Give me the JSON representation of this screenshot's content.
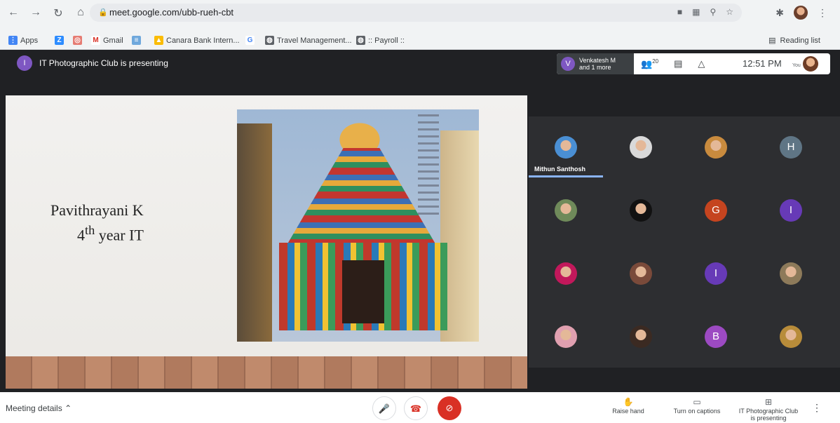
{
  "browser": {
    "url": "meet.google.com/ubb-rueh-cbt",
    "bookmarks": [
      "Apps",
      "Gmail",
      "Canara Bank Intern...",
      "Travel Management...",
      ":: Payroll ::"
    ],
    "reading_list": "Reading list"
  },
  "meet": {
    "presenter_initial": "I",
    "presenting_text": "IT Photographic Club is presenting",
    "active_speaker_initial": "V",
    "active_speaker_name": "Venkatesh M",
    "active_speaker_more": "and 1 more",
    "participant_count": "20",
    "time": "12:51 PM",
    "you_label": "You"
  },
  "slide": {
    "name": "Pavithrayani K",
    "year_num": "4",
    "year_sup": "th",
    "year_rest": " year IT"
  },
  "participants": [
    {
      "type": "photo",
      "color": "#4a8fd4",
      "name": "Mithun Santhosh",
      "speaking": true
    },
    {
      "type": "photo",
      "color": "#d9d9d9"
    },
    {
      "type": "photo",
      "color": "#c98b3e"
    },
    {
      "type": "initial",
      "initial": "H",
      "color": "#5f7585"
    },
    {
      "type": "photo",
      "color": "#6f8a5a"
    },
    {
      "type": "photo",
      "color": "#111111"
    },
    {
      "type": "initial",
      "initial": "G",
      "color": "#c5441f"
    },
    {
      "type": "initial",
      "initial": "I",
      "color": "#673ab7"
    },
    {
      "type": "photo",
      "color": "#c2185b"
    },
    {
      "type": "photo",
      "color": "#7a4a3a"
    },
    {
      "type": "initial",
      "initial": "I",
      "color": "#673ab7"
    },
    {
      "type": "photo",
      "color": "#8d7a5a"
    },
    {
      "type": "photo",
      "color": "#e0a0b0"
    },
    {
      "type": "photo",
      "color": "#3b2a22"
    },
    {
      "type": "initial",
      "initial": "B",
      "color": "#9c4ac2"
    },
    {
      "type": "photo",
      "color": "#b88c3a"
    }
  ],
  "toolbar": {
    "meeting_details": "Meeting details",
    "raise_hand": "Raise hand",
    "captions": "Turn on captions",
    "presenting_line1": "IT Photographic Club",
    "presenting_line2": "is presenting"
  }
}
